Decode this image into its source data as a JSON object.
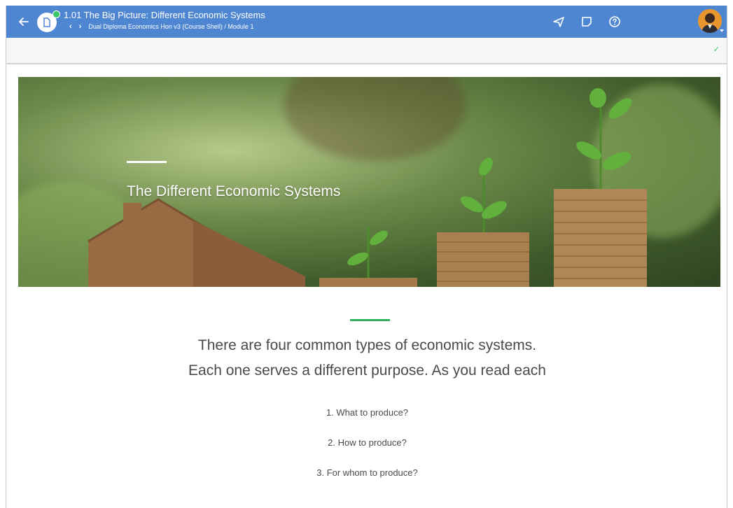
{
  "header": {
    "title": "1.01 The Big Picture: Different Economic Systems",
    "breadcrumb": "Dual Diploma Economics Hon v3 (Course Shell) / Module 1"
  },
  "icons": {
    "back": "arrow-left-icon",
    "document": "document-icon",
    "prev": "chevron-left-icon",
    "next": "chevron-right-icon",
    "send": "paper-plane-icon",
    "notes": "note-icon",
    "help": "help-circle-icon",
    "status": "check-icon"
  },
  "colors": {
    "topbar": "#4f86d2",
    "accent": "#2eb05c",
    "status_dot": "#3cc66b"
  },
  "hero": {
    "title": "The Different Economic Systems"
  },
  "content": {
    "lead_line1": "There are four common types of economic systems.",
    "lead_line2": "Each one serves a different purpose. As you read each",
    "questions": [
      "1. What to produce?",
      "2. How to produce?",
      "3. For whom to produce?"
    ]
  }
}
